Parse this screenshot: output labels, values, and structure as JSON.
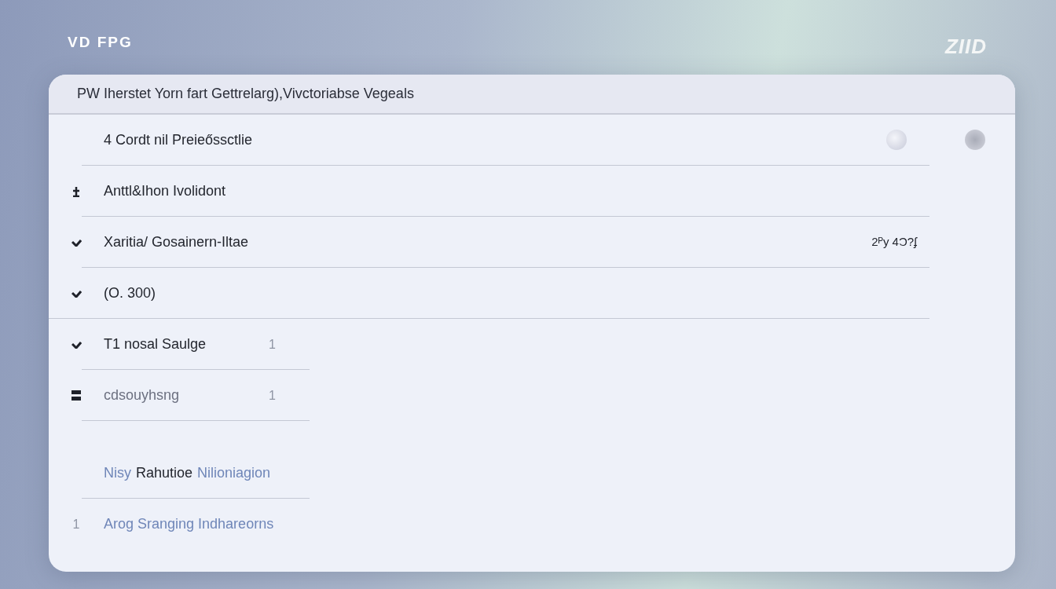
{
  "brand": "VD FPG",
  "logo": "ZIID",
  "panel": {
    "title": "PW Iherstet Yorn fart Gettrelarg),Vivctoriabse Vegeals",
    "rows": [
      {
        "kind": "plain",
        "segments": [
          {
            "text": "4 Cordt nil Preieőssctlie",
            "kind": "dark"
          }
        ],
        "options": [
          {
            "selected": false
          },
          {
            "selected": true
          }
        ]
      },
      {
        "kind": "plus",
        "segments": [
          {
            "text": "Anttl&Ihon Ivolidont",
            "kind": "dark"
          }
        ]
      },
      {
        "kind": "check",
        "segments": [
          {
            "text": "Xaritia/ Gosainern-Iltae",
            "kind": "dark"
          }
        ],
        "aside": {
          "text": "2ᴾy 4Ɔ?ʄ",
          "kind": "value"
        }
      },
      {
        "kind": "check",
        "segments": [
          {
            "text": "(O. 300)",
            "kind": "dark"
          }
        ]
      },
      {
        "kind": "check",
        "segments": [
          {
            "text": "T1 nosal Saulge",
            "kind": "dark"
          }
        ],
        "aside": {
          "text": "1",
          "kind": "faint"
        }
      },
      {
        "kind": "bars",
        "segments": [
          {
            "text": "cdsouyhsng",
            "kind": "muted"
          }
        ],
        "aside": {
          "text": "1",
          "kind": "faint"
        }
      },
      {
        "kind": "plain",
        "segments": [
          {
            "text": "Nisy",
            "kind": "link"
          },
          {
            "text": "Rahutioe",
            "kind": "dark"
          },
          {
            "text": "Nilioniagion",
            "kind": "link"
          }
        ]
      },
      {
        "kind": "plain",
        "marker": "1",
        "segments": [
          {
            "text": "Arog Sranging Indhareorns",
            "kind": "link"
          }
        ]
      }
    ]
  }
}
